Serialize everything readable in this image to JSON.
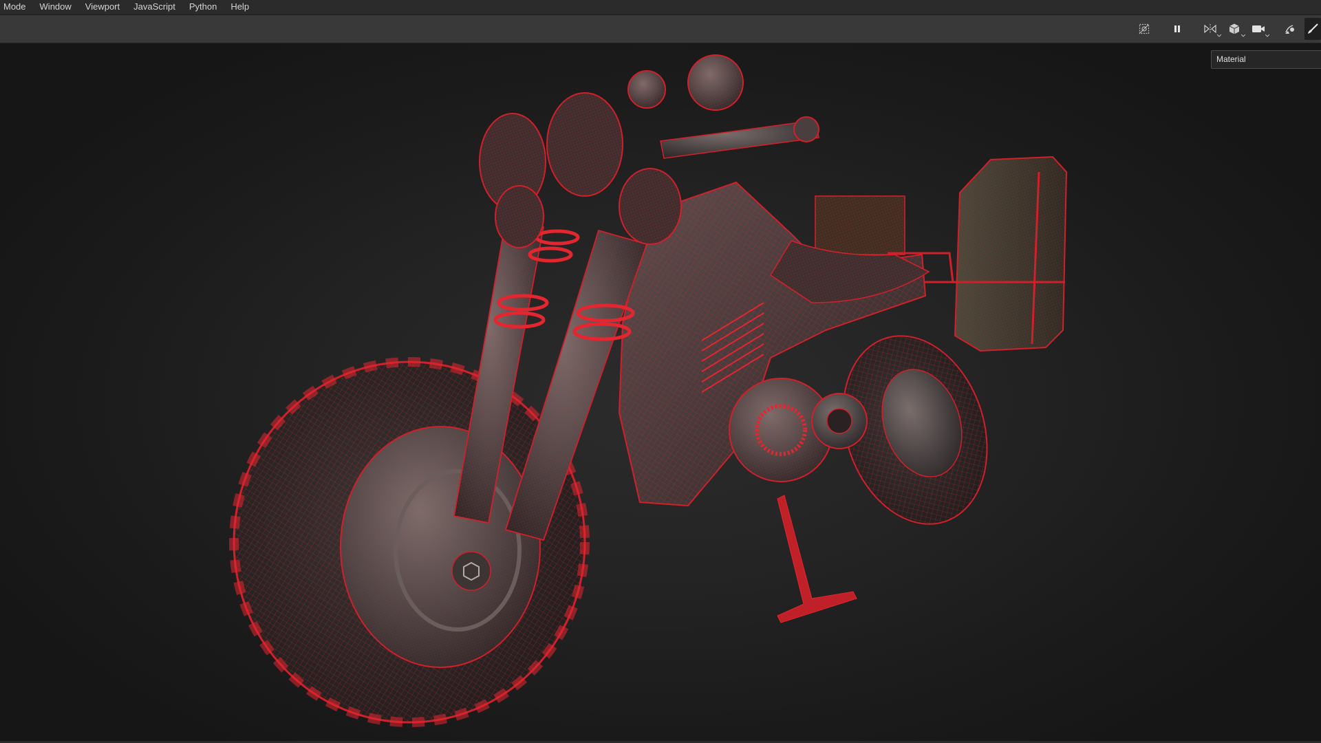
{
  "menu": {
    "items": [
      {
        "label": "Mode"
      },
      {
        "label": "Window"
      },
      {
        "label": "Viewport"
      },
      {
        "label": "JavaScript"
      },
      {
        "label": "Python"
      },
      {
        "label": "Help"
      }
    ]
  },
  "toolbar": {
    "buttons": [
      {
        "icon": "hide-helpers-icon"
      },
      {
        "icon": "pause-icon"
      },
      {
        "icon": "symmetry-icon"
      },
      {
        "icon": "cube-icon"
      },
      {
        "icon": "camera-icon"
      },
      {
        "icon": "lights-icon"
      },
      {
        "icon": "paint-brush-icon"
      }
    ]
  },
  "viewport": {
    "shading_mode": "Material",
    "wireframe_color": "#e3262f",
    "background_color": "#242424"
  }
}
